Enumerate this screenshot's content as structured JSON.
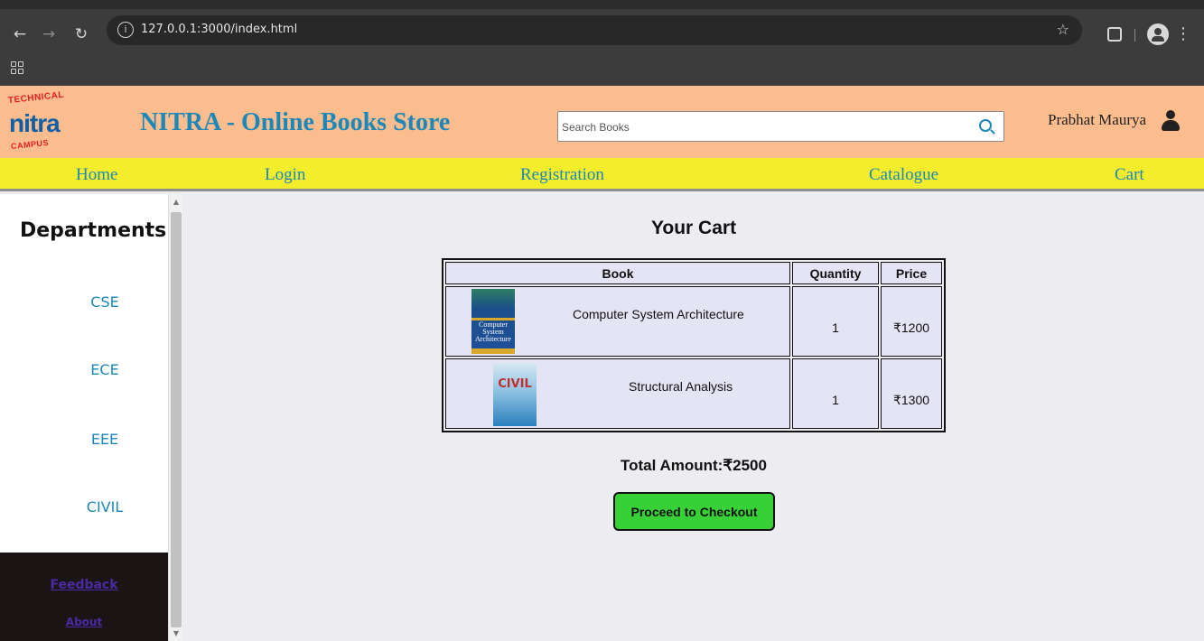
{
  "browser": {
    "url": "127.0.0.1:3000/index.html",
    "icons": [
      "back-icon",
      "forward-icon",
      "reload-icon",
      "site-info-icon",
      "bookmark-star-icon",
      "extensions-icon",
      "profile-icon",
      "menu-icon",
      "apps-icon"
    ]
  },
  "header": {
    "logo": {
      "top": "TECHNICAL",
      "mid": "nitra",
      "bottom": "CAMPUS"
    },
    "title": "NITRA - Online Books Store",
    "search_placeholder": "Search Books",
    "user_name": "Prabhat Maurya"
  },
  "nav": {
    "items": [
      "Home",
      "Login",
      "Registration",
      "Catalogue",
      "Cart"
    ]
  },
  "sidebar": {
    "title": "Departments",
    "departments": [
      "CSE",
      "ECE",
      "EEE",
      "CIVIL"
    ],
    "footer_links": [
      "Feedback",
      "About"
    ]
  },
  "cart": {
    "title": "Your Cart",
    "columns": [
      "Book",
      "Quantity",
      "Price"
    ],
    "items": [
      {
        "book": "Computer System Architecture",
        "cover_text": "Computer System Architecture",
        "quantity": "1",
        "price": "₹1200"
      },
      {
        "book": "Structural Analysis",
        "cover_text": "CIVIL",
        "quantity": "1",
        "price": "₹1300"
      }
    ],
    "total": "Total Amount:₹2500",
    "checkout_label": "Proceed to Checkout"
  },
  "colors": {
    "header_bg": "#fbbd8e",
    "nav_bg": "#f3ed2c",
    "link": "#1c88b9",
    "checkout_bg": "#37d137",
    "sidebar_footer_bg": "#1b1414"
  }
}
